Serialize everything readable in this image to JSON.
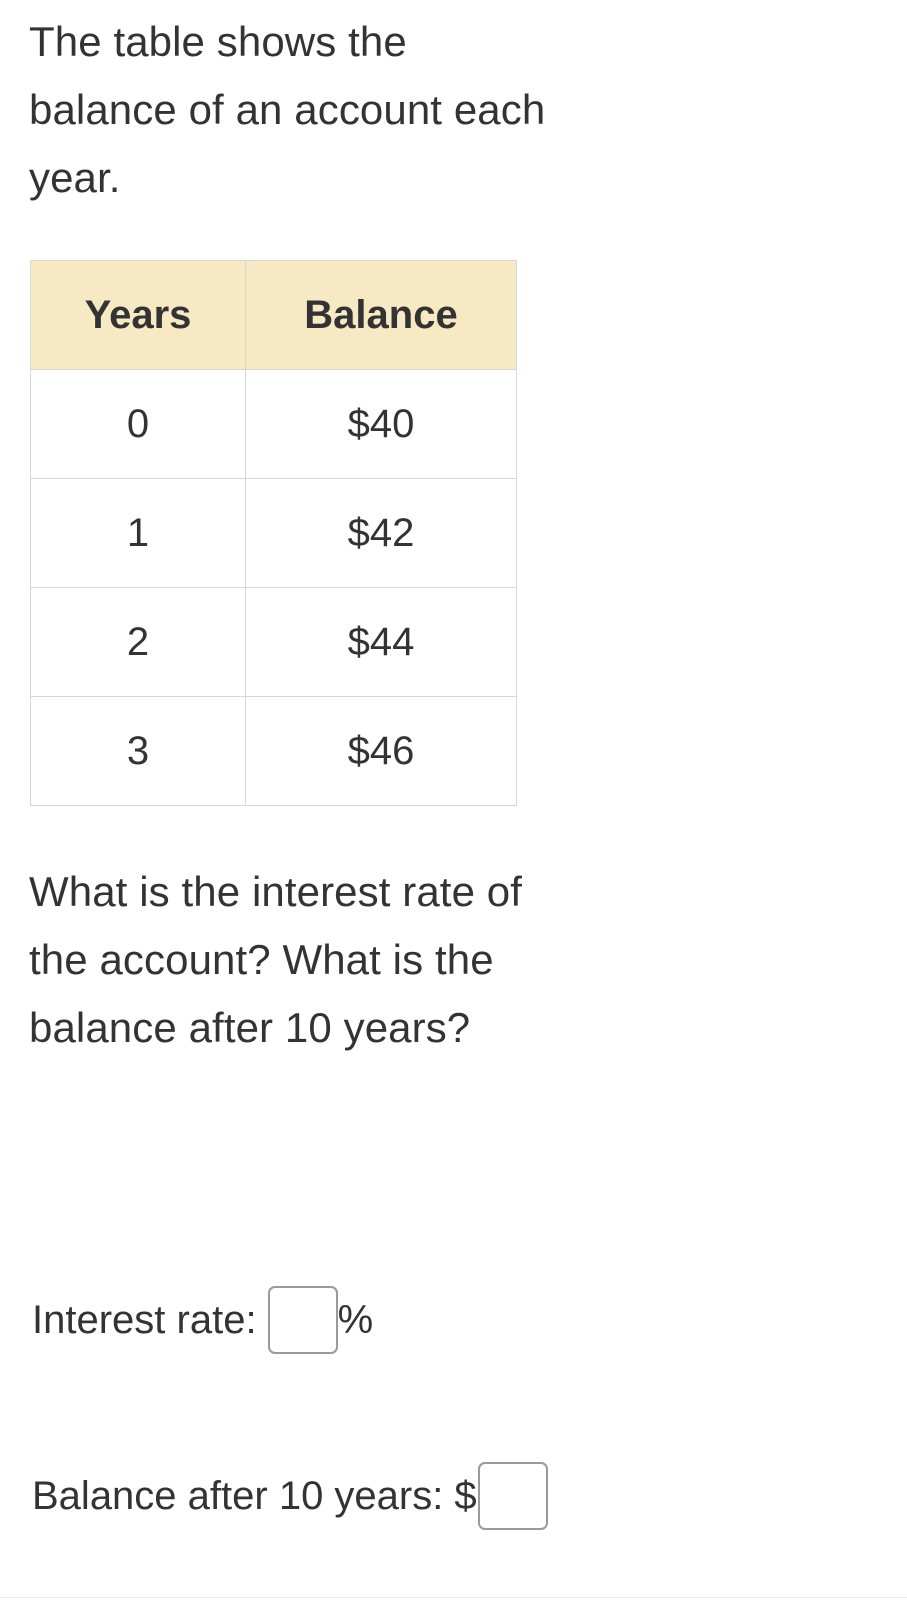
{
  "intro": {
    "text": "The table shows the balance of an account each year."
  },
  "table": {
    "columns": [
      "Years",
      "Balance"
    ],
    "rows": [
      {
        "years": "0",
        "balance": "$40"
      },
      {
        "years": "1",
        "balance": "$42"
      },
      {
        "years": "2",
        "balance": "$44"
      },
      {
        "years": "3",
        "balance": "$46"
      }
    ]
  },
  "question": {
    "text": "What is the interest rate of the account? What is the balance after 10 years?"
  },
  "answers": {
    "interest_rate": {
      "label": "Interest rate:",
      "value": "",
      "placeholder": "",
      "suffix": "%"
    },
    "balance_after_10_years": {
      "label": "Balance after 10 years:",
      "prefix": "$",
      "value": "",
      "placeholder": ""
    }
  },
  "colors": {
    "header_background": "#f7e9c3",
    "text": "#333333",
    "border": "#d7d7d7",
    "input_border": "#9a9a9a"
  }
}
